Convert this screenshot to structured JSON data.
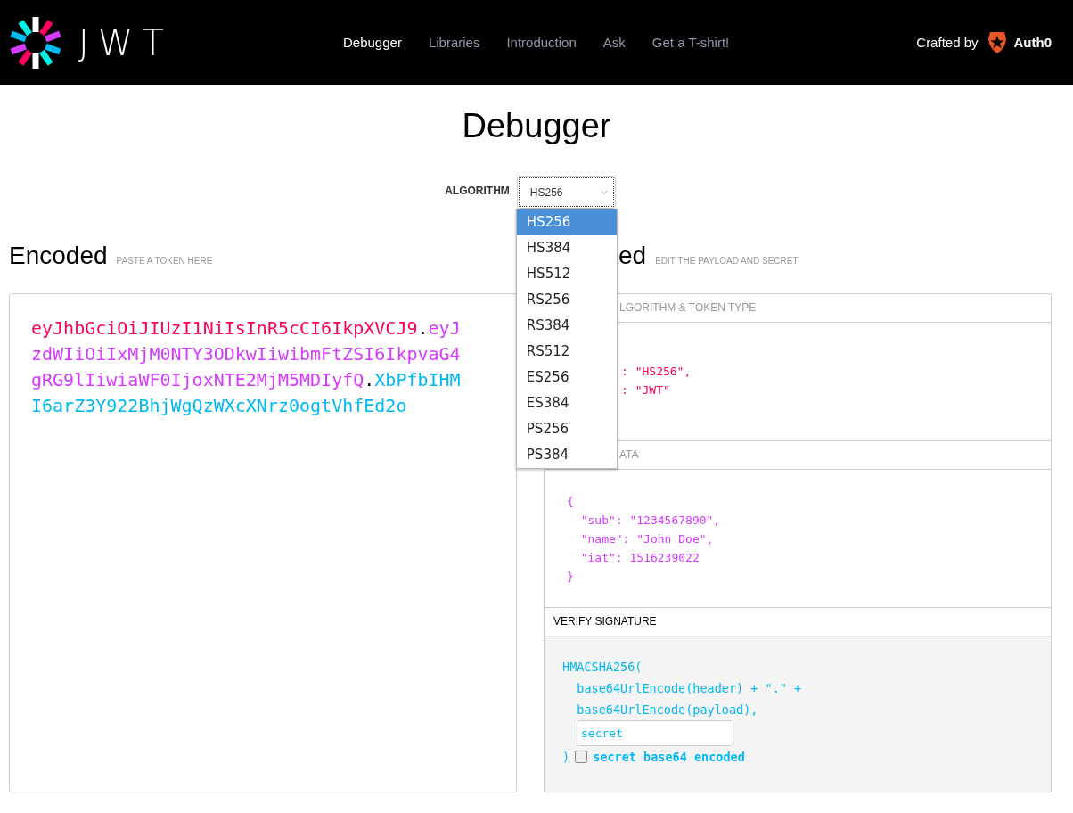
{
  "brand": {
    "logo_text": "JWT"
  },
  "nav": [
    {
      "label": "Debugger",
      "selected": true
    },
    {
      "label": "Libraries",
      "selected": false
    },
    {
      "label": "Introduction",
      "selected": false
    },
    {
      "label": "Ask",
      "selected": false
    },
    {
      "label": "Get a T-shirt!",
      "selected": false
    }
  ],
  "crafted": {
    "label": "Crafted by",
    "brand": "Auth0"
  },
  "page_title": "Debugger",
  "algorithm": {
    "label": "ALGORITHM",
    "value": "HS256",
    "expanded": true,
    "options": [
      {
        "label": "HS256",
        "selected": true
      },
      {
        "label": "HS384",
        "selected": false
      },
      {
        "label": "HS512",
        "selected": false
      },
      {
        "label": "RS256",
        "selected": false
      },
      {
        "label": "RS384",
        "selected": false
      },
      {
        "label": "RS512",
        "selected": false
      },
      {
        "label": "ES256",
        "selected": false
      },
      {
        "label": "ES384",
        "selected": false
      },
      {
        "label": "PS256",
        "selected": false
      },
      {
        "label": "PS384",
        "selected": false
      }
    ]
  },
  "encoded": {
    "title": "Encoded",
    "hint": "PASTE A TOKEN HERE",
    "token": [
      {
        "kind": "header",
        "text": "eyJhbGciOiJIUzI1NiIsInR5cCI6IkpXVCJ9"
      },
      {
        "kind": "dot",
        "text": "."
      },
      {
        "kind": "payload",
        "text": "eyJzdWIiOiIxMjM0NTY3ODkwIiwibmFtZSI6IkpvaG4gRG9lIiwiaWF0IjoxNTE2MjM5MDIyfQ"
      },
      {
        "kind": "dot",
        "text": "."
      },
      {
        "kind": "signature",
        "text": "XbPfbIHMI6arZ3Y922BhjWgQzWXcXNrz0ogtVhfEd2o"
      }
    ]
  },
  "decoded": {
    "title": "ed",
    "hint": "EDIT THE PAYLOAD AND SECRET",
    "header": {
      "title": "LGORITHM & TOKEN TYPE",
      "lines": [
        ": \"HS256\",",
        ": \"JWT\""
      ]
    },
    "payload": {
      "title": "ATA",
      "lines": [
        "{",
        "  \"sub\": \"1234567890\",",
        "  \"name\": \"John Doe\",",
        "  \"iat\": 1516239022",
        "}"
      ]
    },
    "signature": {
      "title": "VERIFY SIGNATURE",
      "lines": [
        "HMACSHA256(",
        "  base64UrlEncode(header) + \".\" +",
        "  base64UrlEncode(payload),"
      ],
      "secret": "secret",
      "closing": ")",
      "base64_checked": false,
      "base64_label": "secret base64 encoded"
    }
  }
}
